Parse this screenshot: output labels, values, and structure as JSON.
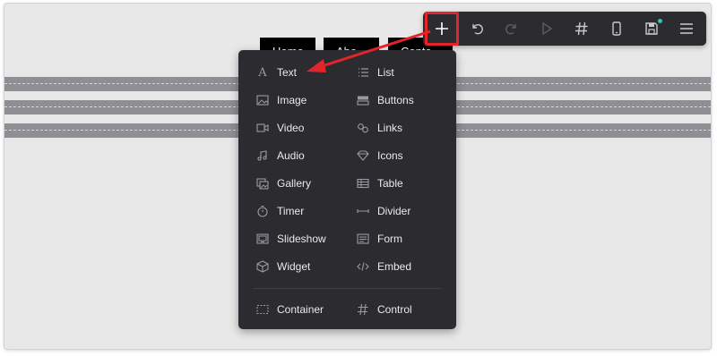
{
  "nav": [
    "Home",
    "Abo",
    "Conta"
  ],
  "toolbar": {
    "buttons": [
      "add-icon",
      "undo-icon",
      "redo-icon",
      "play-icon",
      "hash-icon",
      "mobile-icon",
      "save-icon",
      "menu-icon"
    ]
  },
  "menu": {
    "items": [
      {
        "label": "Text",
        "icon": "text-icon"
      },
      {
        "label": "List",
        "icon": "list-icon"
      },
      {
        "label": "Image",
        "icon": "image-icon"
      },
      {
        "label": "Buttons",
        "icon": "buttons-icon"
      },
      {
        "label": "Video",
        "icon": "video-icon"
      },
      {
        "label": "Links",
        "icon": "links-icon"
      },
      {
        "label": "Audio",
        "icon": "audio-icon"
      },
      {
        "label": "Icons",
        "icon": "diamond-icon"
      },
      {
        "label": "Gallery",
        "icon": "gallery-icon"
      },
      {
        "label": "Table",
        "icon": "table-icon"
      },
      {
        "label": "Timer",
        "icon": "timer-icon"
      },
      {
        "label": "Divider",
        "icon": "divider-icon"
      },
      {
        "label": "Slideshow",
        "icon": "slideshow-icon"
      },
      {
        "label": "Form",
        "icon": "form-icon"
      },
      {
        "label": "Widget",
        "icon": "widget-icon"
      },
      {
        "label": "Embed",
        "icon": "embed-icon"
      },
      {
        "label": "Container",
        "icon": "container-icon"
      },
      {
        "label": "Control",
        "icon": "control-icon"
      }
    ]
  },
  "colors": {
    "toolbar_bg": "#2b2b30",
    "highlight": "#e3242b",
    "status_dot": "#2fc6b3",
    "stripe": "#8f8f93"
  }
}
